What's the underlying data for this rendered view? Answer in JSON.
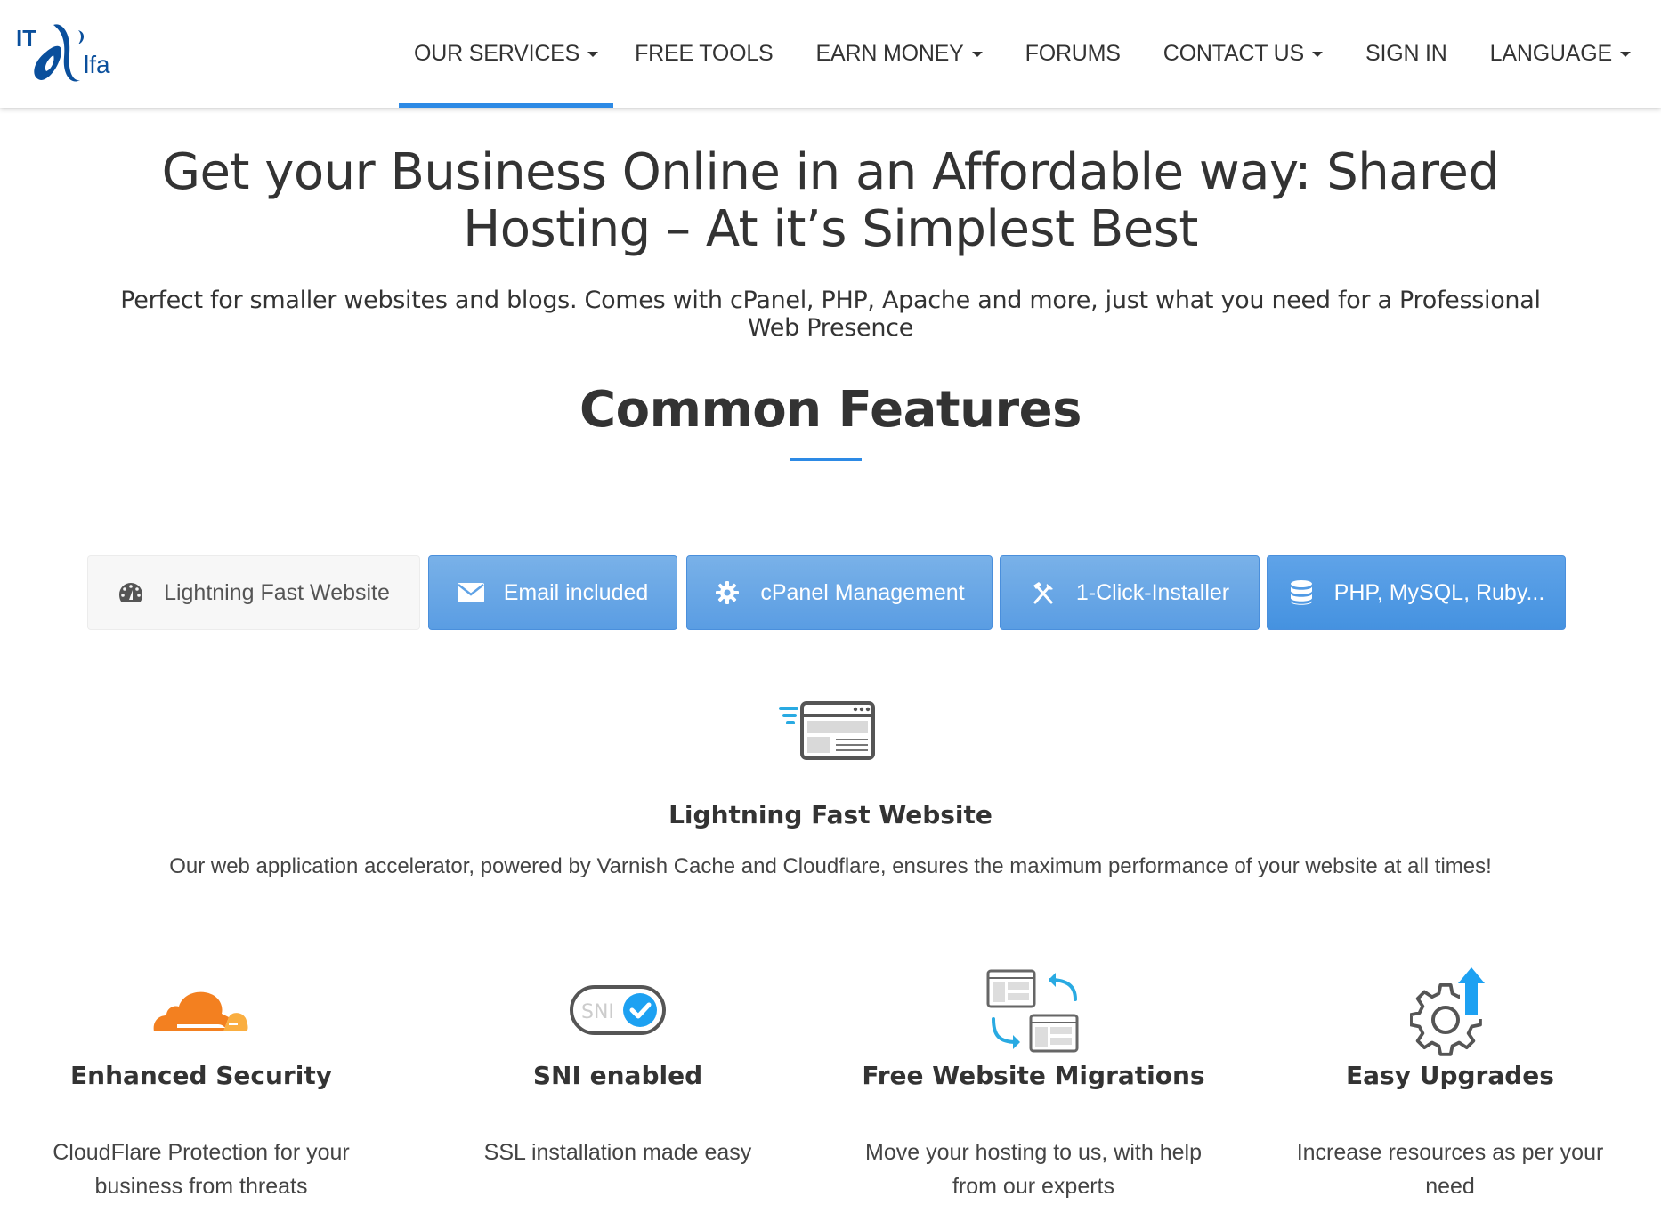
{
  "header": {
    "logo": {
      "text_it": "IT",
      "text_alfa": "lfa",
      "color": "#0a4f9c"
    },
    "nav": [
      {
        "label": "OUR SERVICES",
        "dropdown": true,
        "active": true
      },
      {
        "label": "FREE TOOLS",
        "dropdown": false,
        "active": false
      },
      {
        "label": "EARN MONEY",
        "dropdown": true,
        "active": false
      },
      {
        "label": "FORUMS",
        "dropdown": false,
        "active": false
      },
      {
        "label": "CONTACT US",
        "dropdown": true,
        "active": false
      },
      {
        "label": "SIGN IN",
        "dropdown": false,
        "active": false
      },
      {
        "label": "LANGUAGE",
        "dropdown": true,
        "active": false
      }
    ]
  },
  "hero": {
    "title_line1": "Get your Business Online in an Affordable way: Shared",
    "title_line2": "Hosting – At it’s Simplest Best",
    "subtitle_line1": "Perfect for smaller websites and blogs. Comes with cPanel, PHP, Apache and more, just what you need for a Professional",
    "subtitle_line2": "Web Presence"
  },
  "features": {
    "heading": "Common Features",
    "accent_color": "#2d8ae5",
    "tabs": [
      {
        "label": "Lightning Fast Website",
        "icon": "dashboard-icon",
        "active": true
      },
      {
        "label": "Email included",
        "icon": "envelope-icon",
        "active": false
      },
      {
        "label": "cPanel Management",
        "icon": "gear-icon",
        "active": false
      },
      {
        "label": "1-Click-Installer",
        "icon": "tools-icon",
        "active": false
      },
      {
        "label": "PHP, MySQL, Ruby...",
        "icon": "database-icon",
        "active": false
      }
    ],
    "active_panel": {
      "icon": "fast-browser-icon",
      "title": "Lightning Fast Website",
      "description": "Our web application accelerator, powered by Varnish Cache and Cloudflare, ensures the maximum performance of your website at all times!"
    }
  },
  "highlights": [
    {
      "icon": "cloudflare-icon",
      "title": "Enhanced Security",
      "desc_line1": "CloudFlare Protection for your",
      "desc_line2": "business from threats"
    },
    {
      "icon": "sni-toggle-icon",
      "icon_text": "SNI",
      "title": "SNI enabled",
      "desc_line1": "SSL installation made easy",
      "desc_line2": ""
    },
    {
      "icon": "migration-icon",
      "title": "Free Website Migrations",
      "desc_line1": "Move your hosting to us, with help",
      "desc_line2": "from our experts"
    },
    {
      "icon": "upgrade-gear-icon",
      "title": "Easy Upgrades",
      "desc_line1": "Increase resources as per your need",
      "desc_line2": ""
    }
  ]
}
